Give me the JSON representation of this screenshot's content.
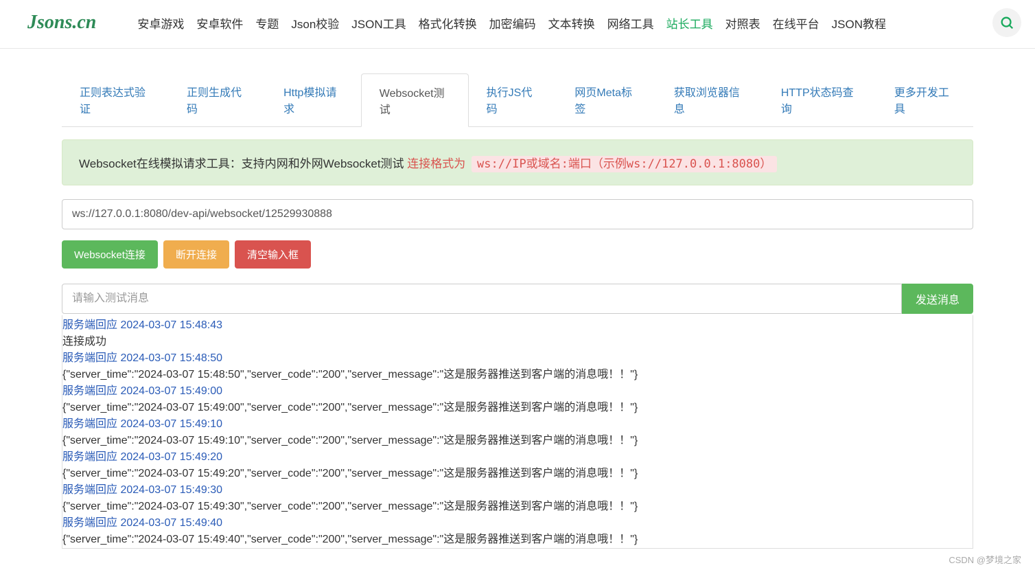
{
  "logo": "Jsons.cn",
  "nav": [
    {
      "label": "安卓游戏",
      "active": false
    },
    {
      "label": "安卓软件",
      "active": false
    },
    {
      "label": "专题",
      "active": false
    },
    {
      "label": "Json校验",
      "active": false
    },
    {
      "label": "JSON工具",
      "active": false
    },
    {
      "label": "格式化转换",
      "active": false
    },
    {
      "label": "加密编码",
      "active": false
    },
    {
      "label": "文本转换",
      "active": false
    },
    {
      "label": "网络工具",
      "active": false
    },
    {
      "label": "站长工具",
      "active": true
    },
    {
      "label": "对照表",
      "active": false
    },
    {
      "label": "在线平台",
      "active": false
    },
    {
      "label": "JSON教程",
      "active": false
    }
  ],
  "tabs": [
    {
      "label": "正则表达式验证",
      "active": false
    },
    {
      "label": "正则生成代码",
      "active": false
    },
    {
      "label": "Http模拟请求",
      "active": false
    },
    {
      "label": "Websocket测试",
      "active": true
    },
    {
      "label": "执行JS代码",
      "active": false
    },
    {
      "label": "网页Meta标签",
      "active": false
    },
    {
      "label": "获取浏览器信息",
      "active": false
    },
    {
      "label": "HTTP状态码查询",
      "active": false
    },
    {
      "label": "更多开发工具",
      "active": false
    }
  ],
  "banner": {
    "text": "Websocket在线模拟请求工具：支持内网和外网Websocket测试",
    "hint_label": "连接格式为",
    "hint_example": "ws://IP或域名:端口（示例ws://127.0.0.1:8080）"
  },
  "ws_url": "ws://127.0.0.1:8080/dev-api/websocket/12529930888",
  "buttons": {
    "connect": "Websocket连接",
    "disconnect": "断开连接",
    "clear": "清空输入框",
    "send": "发送消息"
  },
  "msg_placeholder": "请输入测试消息",
  "log": [
    {
      "type": "header",
      "text": "服务端回应 2024-03-07 15:48:43"
    },
    {
      "type": "body",
      "text": "连接成功"
    },
    {
      "type": "header",
      "text": "服务端回应 2024-03-07 15:48:50"
    },
    {
      "type": "body",
      "text": "{\"server_time\":\"2024-03-07 15:48:50\",\"server_code\":\"200\",\"server_message\":\"这是服务器推送到客户端的消息哦！！\"}"
    },
    {
      "type": "header",
      "text": "服务端回应 2024-03-07 15:49:00"
    },
    {
      "type": "body",
      "text": "{\"server_time\":\"2024-03-07 15:49:00\",\"server_code\":\"200\",\"server_message\":\"这是服务器推送到客户端的消息哦！！\"}"
    },
    {
      "type": "header",
      "text": "服务端回应 2024-03-07 15:49:10"
    },
    {
      "type": "body",
      "text": "{\"server_time\":\"2024-03-07 15:49:10\",\"server_code\":\"200\",\"server_message\":\"这是服务器推送到客户端的消息哦！！\"}"
    },
    {
      "type": "header",
      "text": "服务端回应 2024-03-07 15:49:20"
    },
    {
      "type": "body",
      "text": "{\"server_time\":\"2024-03-07 15:49:20\",\"server_code\":\"200\",\"server_message\":\"这是服务器推送到客户端的消息哦！！\"}"
    },
    {
      "type": "header",
      "text": "服务端回应 2024-03-07 15:49:30"
    },
    {
      "type": "body",
      "text": "{\"server_time\":\"2024-03-07 15:49:30\",\"server_code\":\"200\",\"server_message\":\"这是服务器推送到客户端的消息哦！！\"}"
    },
    {
      "type": "header",
      "text": "服务端回应 2024-03-07 15:49:40"
    },
    {
      "type": "body",
      "text": "{\"server_time\":\"2024-03-07 15:49:40\",\"server_code\":\"200\",\"server_message\":\"这是服务器推送到客户端的消息哦！！\"}"
    }
  ],
  "footer": "CSDN @梦境之家"
}
